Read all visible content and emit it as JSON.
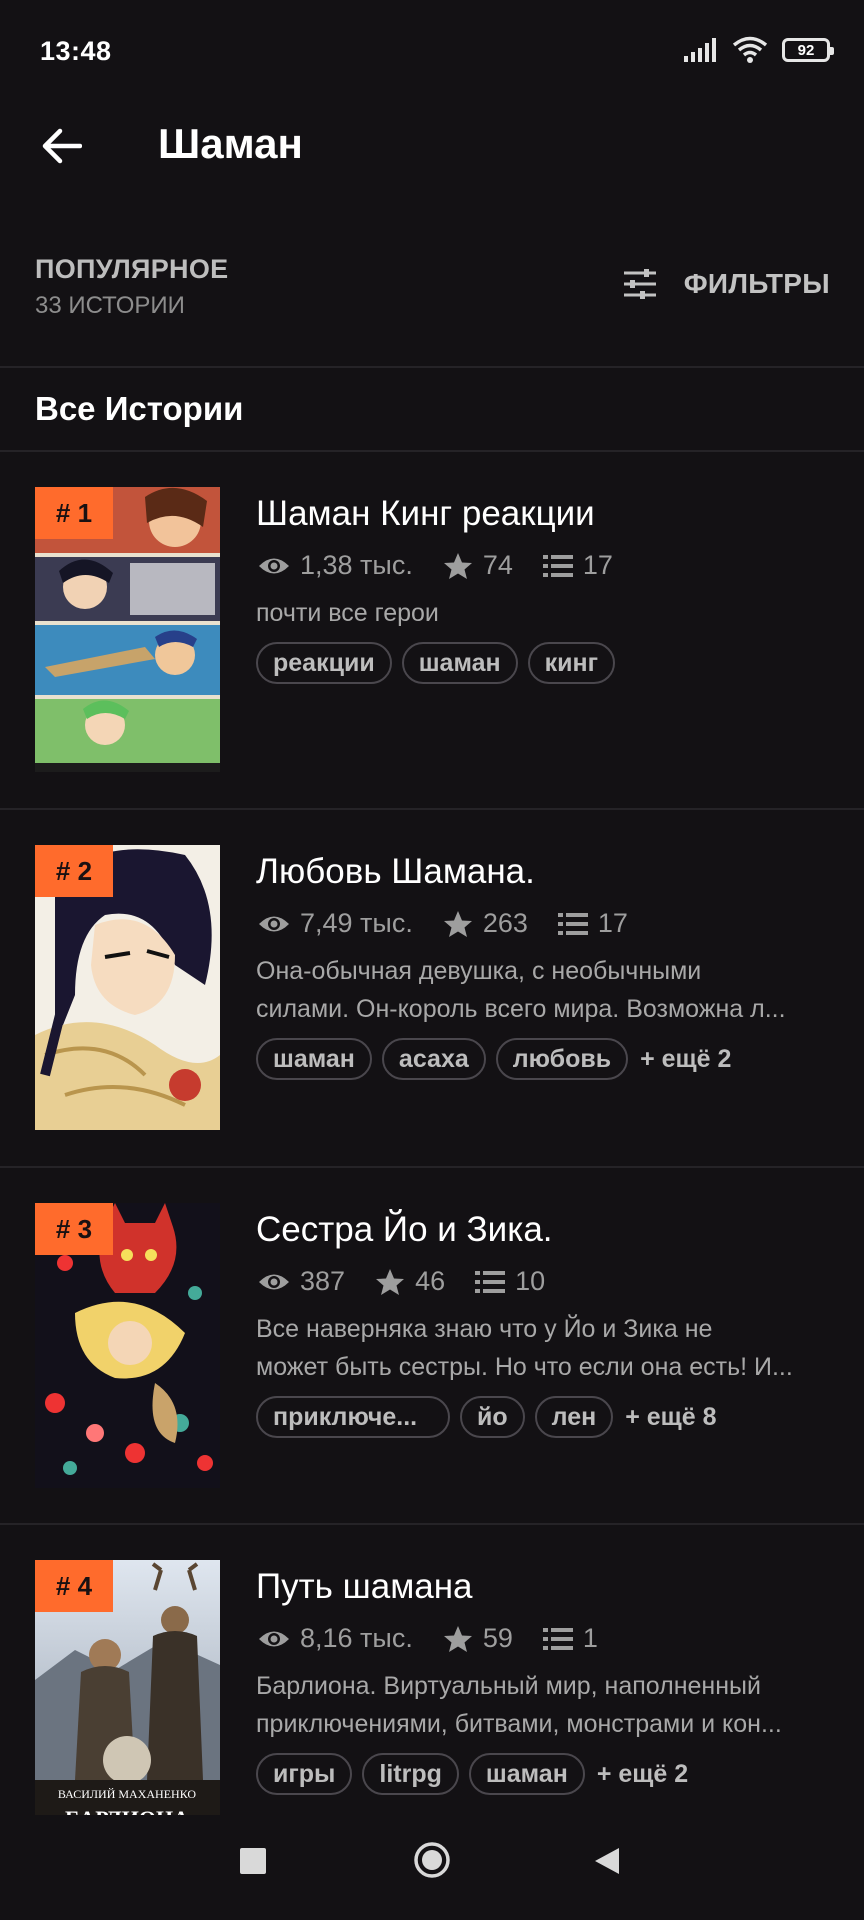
{
  "status_bar": {
    "time": "13:48",
    "battery": "92"
  },
  "app_bar": {
    "title": "Шаман",
    "back_icon": "arrow-left-icon"
  },
  "sort": {
    "label": "ПОПУЛЯРНОЕ",
    "count": "33 ИСТОРИИ",
    "filters_label": "ФИЛЬТРЫ",
    "filters_icon": "sliders-icon"
  },
  "section_title": "Все Истории",
  "colors": {
    "background": "#131114",
    "accent": "#ff6b2c",
    "muted_text": "#a8a8a8",
    "tag_border": "#4a474d"
  },
  "stories": [
    {
      "rank": "# 1",
      "title": "Шаман Кинг реакции",
      "views": "1,38 тыс.",
      "votes": "74",
      "parts": "17",
      "description": [
        "почти все герои"
      ],
      "tags": [
        "реакции",
        "шаман",
        "кинг"
      ],
      "more": ""
    },
    {
      "rank": "# 2",
      "title": " Любовь Шамана.",
      "views": "7,49 тыс.",
      "votes": "263",
      "parts": "17",
      "description": [
        "Она-обычная девушка, с необычными",
        "силами. Он-король всего мира. Возможна л..."
      ],
      "tags": [
        "шаман",
        "асаха",
        "любовь"
      ],
      "more": "+ ещё 2"
    },
    {
      "rank": "# 3",
      "title": "Сестра Йо и Зика.",
      "views": "387",
      "votes": "46",
      "parts": "10",
      "description": [
        "Все наверняка знаю что у Йо и Зика не",
        "может быть сестры. Но что если она есть! И..."
      ],
      "tags": [
        "приключе...",
        "йо",
        "лен"
      ],
      "more": "+ ещё 8"
    },
    {
      "rank": "# 4",
      "title": "Путь шамана",
      "views": "8,16 тыс.",
      "votes": "59",
      "parts": "1",
      "description": [
        "Барлиона. Виртуальный мир, наполненный",
        "приключениями, битвами, монстрами и кон..."
      ],
      "tags": [
        "игры",
        "litrpg",
        "шаман"
      ],
      "more": "+ ещё 2",
      "cover_text": [
        "ВАСИЛИЙ МАХАНЕНКО",
        "БАРЛИОНА"
      ]
    }
  ]
}
